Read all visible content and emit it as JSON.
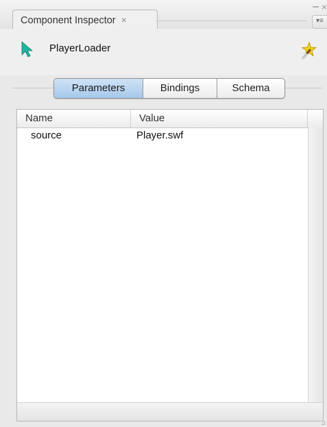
{
  "tab": {
    "title": "Component Inspector",
    "close_glyph": "×"
  },
  "window": {
    "minimize_glyph": "–",
    "close_glyph": "×",
    "menu_glyph": "▾≡"
  },
  "component": {
    "name": "PlayerLoader",
    "icon": "arrow-cursor-icon",
    "action_icon": "magic-wand-icon"
  },
  "segments": [
    {
      "label": "Parameters",
      "active": true
    },
    {
      "label": "Bindings",
      "active": false
    },
    {
      "label": "Schema",
      "active": false
    }
  ],
  "table": {
    "columns": [
      "Name",
      "Value"
    ],
    "rows": [
      {
        "name": "source",
        "value": "Player.swf"
      }
    ]
  },
  "colors": {
    "accent": "#a6c8ea",
    "arrow": "#1fb5a0"
  }
}
